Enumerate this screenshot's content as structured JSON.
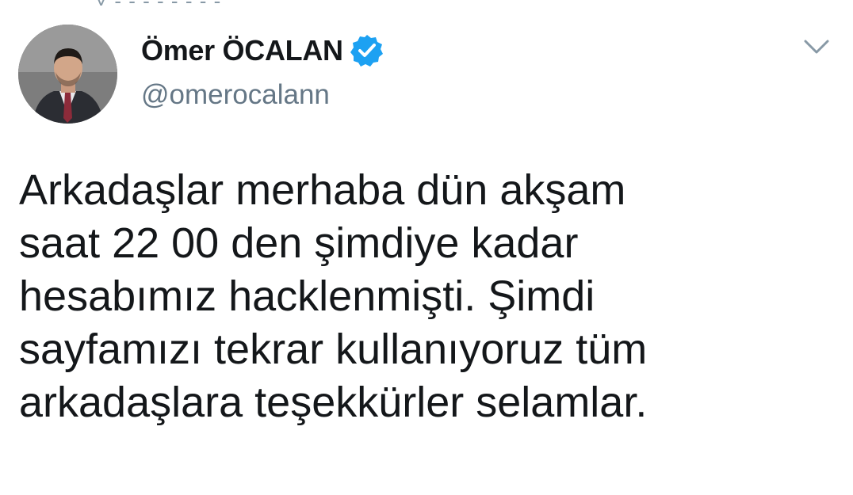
{
  "tweet": {
    "author": {
      "display_name": "Ömer ÖCALAN",
      "handle": "@omerocalann",
      "verified": true,
      "avatar_icon": "profile-photo-man-in-suit"
    },
    "menu_icon": "chevron-down-icon",
    "text": "Arkadaşlar merhaba dün akşam\nsaat 22 00 den şimdiye kadar\nhesabımız hacklenmişti. Şimdi\nsayfamızı tekrar kullanıyoruz tüm\narkadaşlara teşekkürler selamlar."
  },
  "colors": {
    "verified_badge": "#1da1f2",
    "name_text": "#14171a",
    "handle_text": "#657786",
    "chevron": "#8899a6"
  }
}
